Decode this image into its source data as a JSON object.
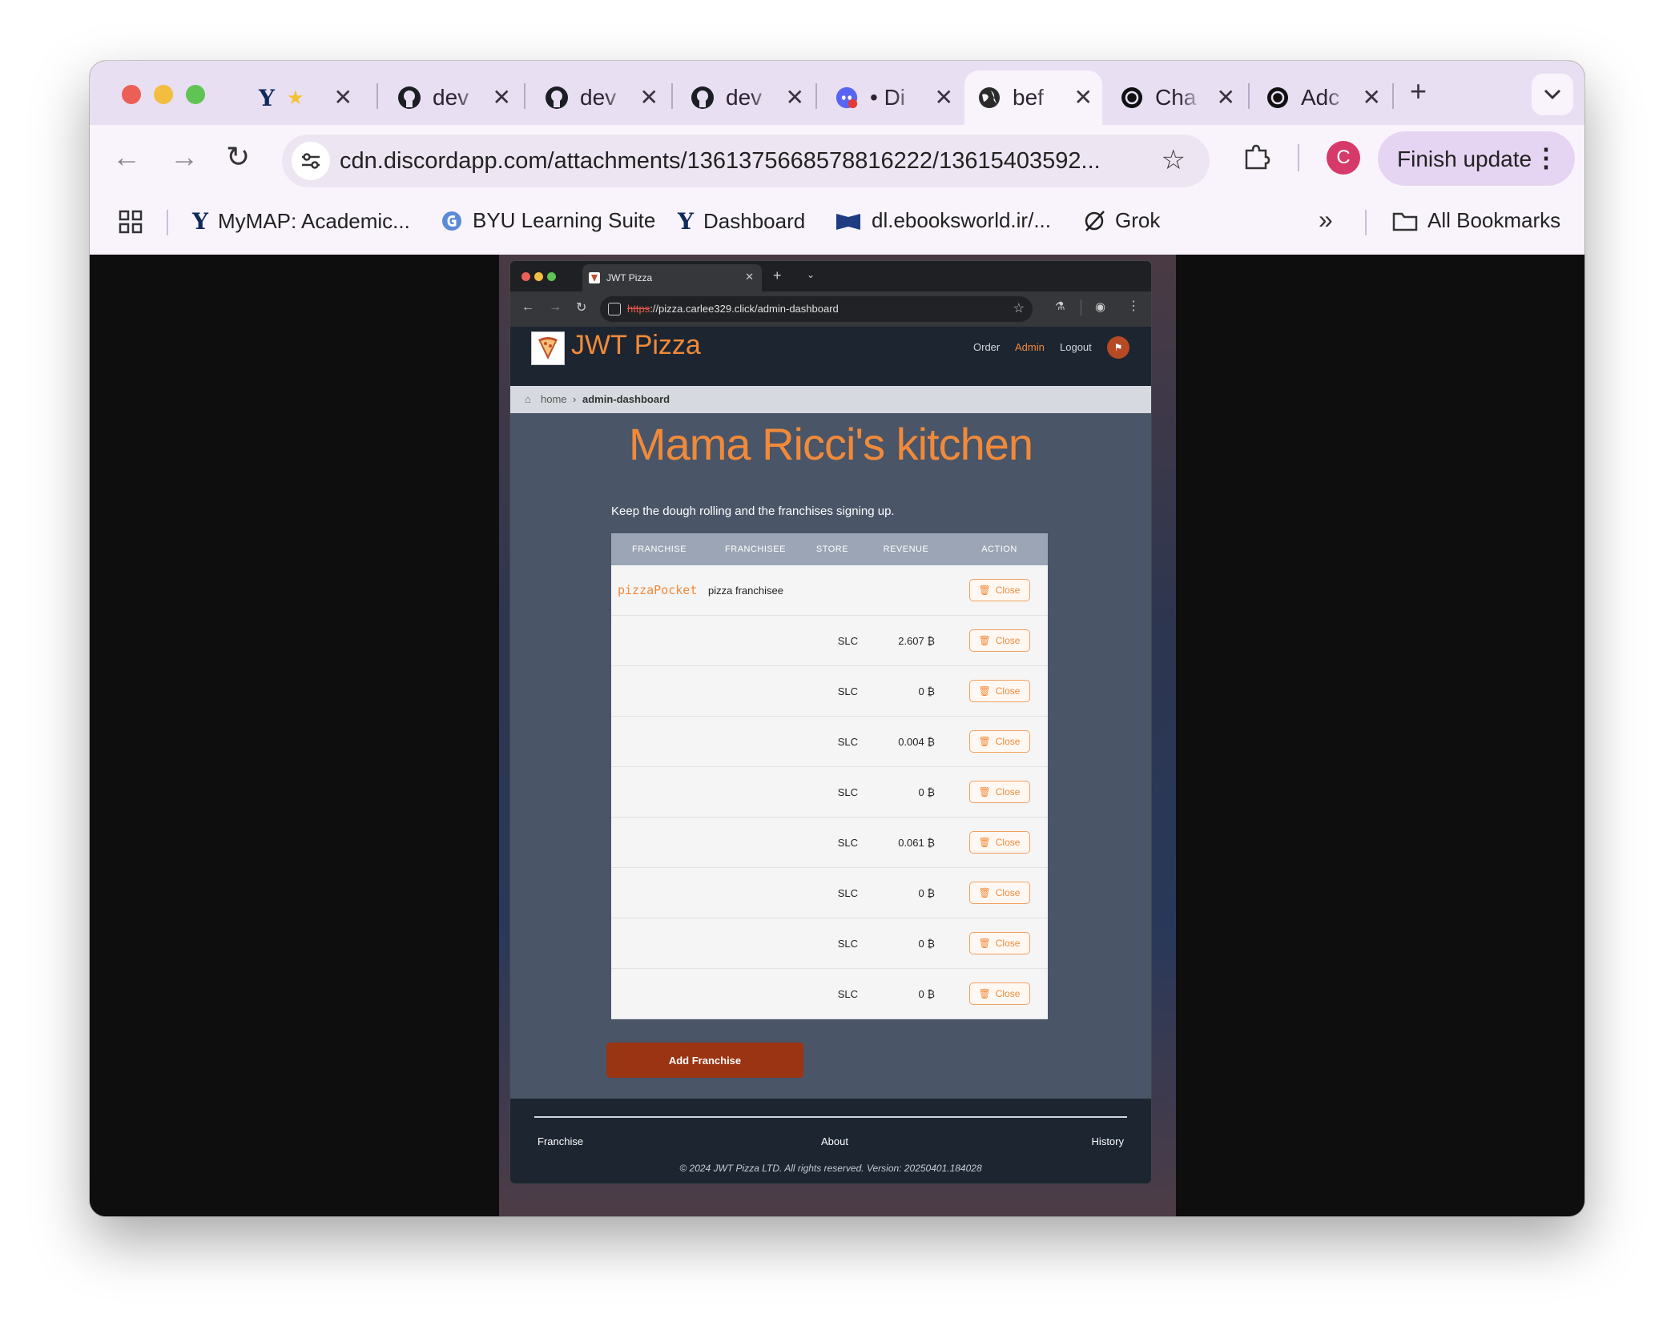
{
  "browser": {
    "tabs": [
      {
        "title": "Y",
        "icon": "byu-y-icon"
      },
      {
        "title": "dev",
        "icon": "github-icon"
      },
      {
        "title": "dev",
        "icon": "github-icon"
      },
      {
        "title": "dev",
        "icon": "github-icon"
      },
      {
        "title": "• Di",
        "icon": "discord-icon"
      },
      {
        "title": "bef",
        "icon": "globe-icon"
      },
      {
        "title": "Cha",
        "icon": "openai-icon"
      },
      {
        "title": "Adc",
        "icon": "openai-icon"
      }
    ],
    "url": "cdn.discordapp.com/attachments/1361375668578816222/13615403592...",
    "profile_initial": "C",
    "finish_update_label": "Finish update",
    "bookmarks": [
      {
        "label": "MyMAP: Academic...",
        "icon": "byu-y-icon"
      },
      {
        "label": "BYU Learning Suite",
        "icon": "learning-suite-icon"
      },
      {
        "label": "Dashboard",
        "icon": "byu-y-icon"
      },
      {
        "label": "dl.ebooksworld.ir/...",
        "icon": "ebook-icon"
      },
      {
        "label": "Grok",
        "icon": "grok-icon"
      }
    ],
    "all_bookmarks_label": "All Bookmarks",
    "colors": {
      "tabstrip": "#e9dff2",
      "toolbar": "#f9f4fc"
    }
  },
  "inner_browser": {
    "tab_title": "JWT Pizza",
    "url_scheme": "https",
    "url_rest": "://pizza.carlee329.click/admin-dashboard"
  },
  "app": {
    "brand": "JWT Pizza",
    "nav": {
      "order": "Order",
      "admin": "Admin",
      "logout": "Logout"
    },
    "avatar_icon": "user-avatar-icon",
    "breadcrumb": {
      "home": "home",
      "current": "admin-dashboard"
    },
    "heading": "Mama Ricci's kitchen",
    "subtitle": "Keep the dough rolling and the franchises signing up.",
    "table": {
      "headers": [
        "FRANCHISE",
        "FRANCHISEE",
        "STORE",
        "REVENUE",
        "ACTION"
      ],
      "franchise_row": {
        "name": "pizzaPocket",
        "franchisee": "pizza franchisee",
        "action": "Close"
      },
      "stores": [
        {
          "store": "SLC",
          "revenue": "2.607 ₿",
          "action": "Close"
        },
        {
          "store": "SLC",
          "revenue": "0 ₿",
          "action": "Close"
        },
        {
          "store": "SLC",
          "revenue": "0.004 ₿",
          "action": "Close"
        },
        {
          "store": "SLC",
          "revenue": "0 ₿",
          "action": "Close"
        },
        {
          "store": "SLC",
          "revenue": "0.061 ₿",
          "action": "Close"
        },
        {
          "store": "SLC",
          "revenue": "0 ₿",
          "action": "Close"
        },
        {
          "store": "SLC",
          "revenue": "0 ₿",
          "action": "Close"
        },
        {
          "store": "SLC",
          "revenue": "0 ₿",
          "action": "Close"
        }
      ]
    },
    "add_button": "Add Franchise",
    "footer": {
      "links": [
        "Franchise",
        "About",
        "History"
      ],
      "copyright": "© 2024 JWT Pizza LTD. All rights reserved. Version: 20250401.184028"
    },
    "colors": {
      "accent": "#f08a3a",
      "header": "#1d2531",
      "main": "#4a5568",
      "button": "#9a3412"
    }
  }
}
